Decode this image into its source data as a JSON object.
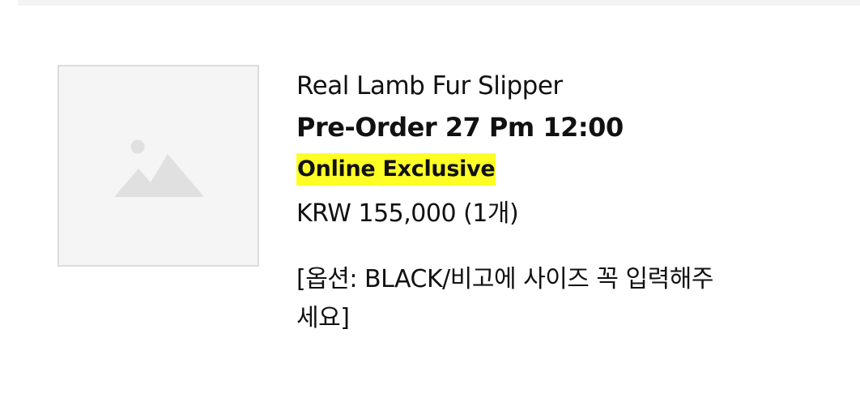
{
  "product": {
    "name": "Real Lamb Fur Slipper",
    "preorder": "Pre-Order 27 Pm 12:00",
    "badge": "Online Exclusive",
    "price": "KRW 155,000 (1개)",
    "option_line1": "[옵션: BLACK/비고에 사이즈 꼭 입력해주",
    "option_line2": "세요]",
    "thumbnail_icon": "image-placeholder-icon"
  },
  "colors": {
    "badge_highlight": "#ffff26",
    "thumbnail_border": "#dcdcdc",
    "thumbnail_bg": "#f5f5f5",
    "placeholder_icon": "#e0e0e0"
  }
}
